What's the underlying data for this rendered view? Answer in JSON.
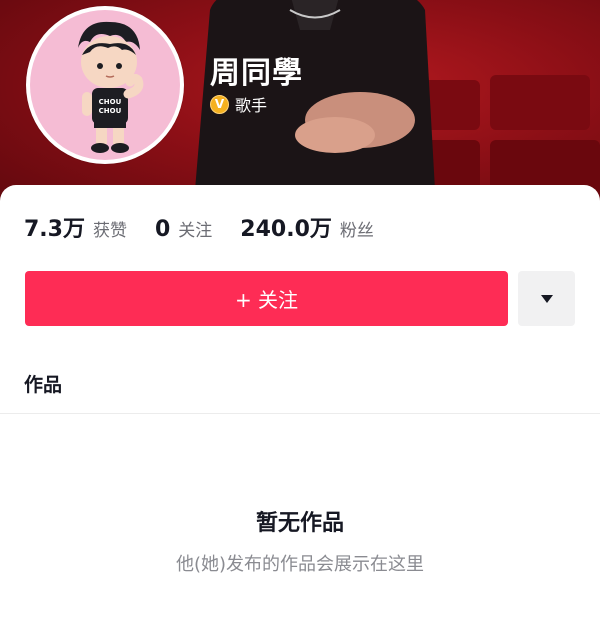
{
  "profile": {
    "name": "周同學",
    "verify_badge": "V",
    "verify_label": "歌手"
  },
  "stats": [
    {
      "value": "7.3万",
      "label": "获赞"
    },
    {
      "value": "0",
      "label": "关注"
    },
    {
      "value": "240.0万",
      "label": "粉丝"
    }
  ],
  "actions": {
    "follow_label": "+ 关注",
    "more_icon": "caret-down-icon"
  },
  "tabs": {
    "works_label": "作品"
  },
  "empty": {
    "title": "暂无作品",
    "subtitle": "他(她)发布的作品会展示在这里"
  },
  "colors": {
    "accent": "#fe2c55",
    "header_red": "#8c0f16",
    "avatar_bg": "#f5bcd4",
    "badge": "#f5b120"
  }
}
